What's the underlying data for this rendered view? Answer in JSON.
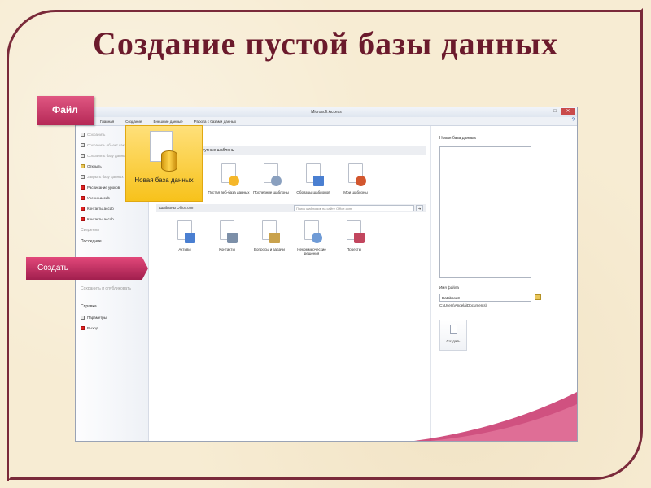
{
  "slide": {
    "title": "Создание пустой базы данных"
  },
  "window": {
    "title": "Microsoft Access",
    "tabs": [
      "Главная",
      "Создание",
      "Внешние данные",
      "Работа с базами данных"
    ],
    "help": "?"
  },
  "sidebar": {
    "items": [
      {
        "label": "Сохранить",
        "dim": true
      },
      {
        "label": "Сохранить объект как",
        "dim": true
      },
      {
        "label": "Сохранить базу данных как",
        "dim": true
      },
      {
        "label": "Открыть",
        "dim": false
      },
      {
        "label": "Закрыть базу данных",
        "dim": true
      }
    ],
    "recent": [
      "Расписание уроков",
      "Ученик.accdb",
      "Контакты.accdb",
      "Контакты.accdb"
    ],
    "section_info": "Сведения",
    "section_recent": "Последние",
    "section_print": "Сохранить и опубликовать",
    "section_help": "Справка",
    "params": "Параметры",
    "exit": "Выход"
  },
  "main": {
    "header": "Доступные шаблоны",
    "templates_top": [
      {
        "label": "Пустая веб-база данных",
        "color": "#f5b72a"
      },
      {
        "label": "Последние шаблоны",
        "color": "#8aa0bf"
      },
      {
        "label": "Образцы шаблонов",
        "color": "#4a7fd1"
      },
      {
        "label": "Мои шаблоны",
        "color": "#d2562e"
      }
    ],
    "office_bar": "Шаблоны Office.com",
    "office_search_placeholder": "Поиск шаблонов на сайте Office.com",
    "templates_office": [
      {
        "label": "Активы",
        "color": "#4a7fd1"
      },
      {
        "label": "Контакты",
        "color": "#7c8fa8"
      },
      {
        "label": "Вопросы и задачи",
        "color": "#c9a24d"
      },
      {
        "label": "Некоммерческие решения",
        "color": "#6f9bd6"
      },
      {
        "label": "Проекты",
        "color": "#c2465e"
      }
    ]
  },
  "right_pane": {
    "title": "Новая база данных",
    "file_label": "Имя файла",
    "file_value": "Database3",
    "path": "C:\\Users\\Angela\\Documents\\",
    "create_label": "Создать"
  },
  "callouts": {
    "file": "Файл",
    "create": "Создать",
    "new_db": "Новая база данных"
  },
  "colors": {
    "accent": "#c8336a",
    "highlight": "#f7c21b",
    "title": "#6b1a2c"
  }
}
